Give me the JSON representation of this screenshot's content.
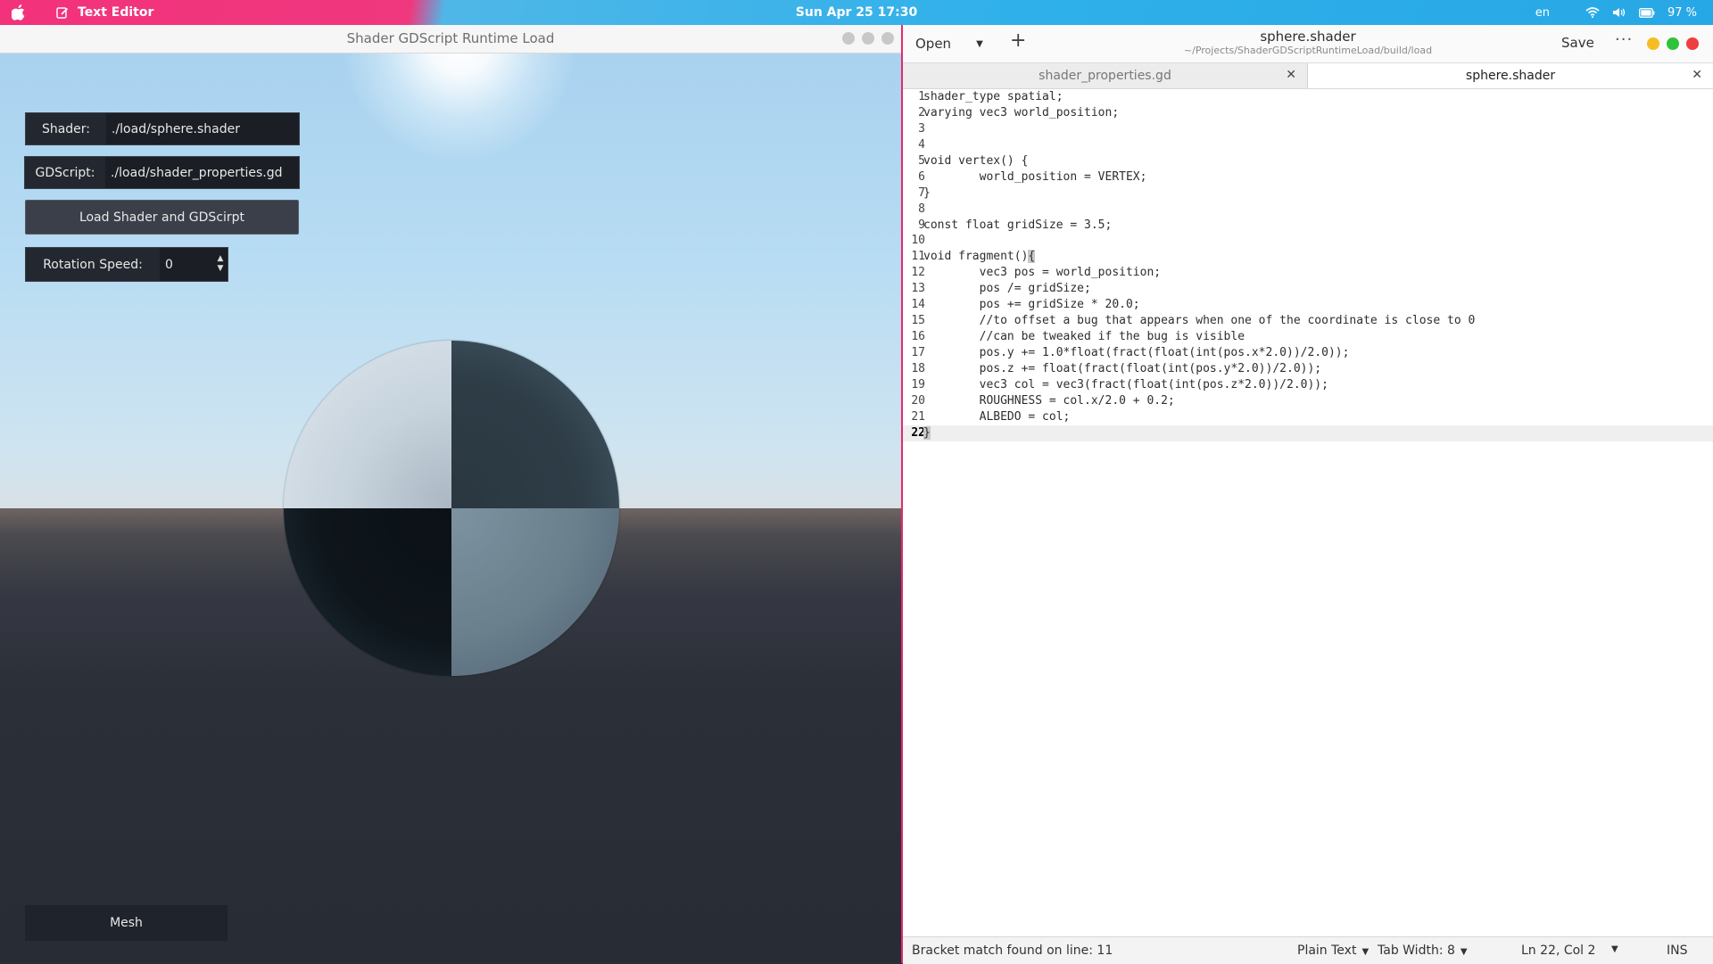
{
  "topbar": {
    "app_name": "Text Editor",
    "clock": "Sun Apr 25  17:30",
    "language": "en",
    "battery": "97 %"
  },
  "app_window": {
    "title": "Shader GDScript Runtime Load",
    "shader_label": "Shader:",
    "shader_value": "./load/sphere.shader",
    "gdscript_label": "GDScript:",
    "gdscript_value": "./load/shader_properties.gd",
    "load_button": "Load Shader and GDScirpt",
    "rotation_label": "Rotation Speed:",
    "rotation_value": "0",
    "mesh_button": "Mesh"
  },
  "editor": {
    "open_label": "Open",
    "doc_title": "sphere.shader",
    "doc_path": "~/Projects/ShaderGDScriptRuntimeLoad/build/load",
    "save_label": "Save",
    "traffic_colors": [
      "#f5bd22",
      "#2ec33b",
      "#f03d3d"
    ],
    "tabs": [
      {
        "label": "shader_properties.gd",
        "active": false
      },
      {
        "label": "sphere.shader",
        "active": true
      }
    ],
    "lines": [
      "shader_type spatial;",
      "varying vec3 world_position;",
      "",
      "",
      "void vertex() {",
      "        world_position = VERTEX;",
      "}",
      "",
      "const float gridSize = 3.5;",
      "",
      "void fragment(){",
      "        vec3 pos = world_position;",
      "        pos /= gridSize;",
      "        pos += gridSize * 20.0;",
      "        //to offset a bug that appears when one of the coordinate is close to 0",
      "        //can be tweaked if the bug is visible",
      "        pos.y += 1.0*float(fract(float(int(pos.x*2.0))/2.0));",
      "        pos.z += float(fract(float(int(pos.y*2.0))/2.0));",
      "        vec3 col = vec3(fract(float(int(pos.z*2.0))/2.0));",
      "        ROUGHNESS = col.x/2.0 + 0.2;",
      "        ALBEDO = col;",
      "}"
    ],
    "current_line": 22,
    "status": {
      "message": "Bracket match found on line: 11",
      "language": "Plain Text",
      "tab_width": "Tab Width: 8",
      "position": "Ln 22, Col 2",
      "mode": "INS"
    }
  }
}
